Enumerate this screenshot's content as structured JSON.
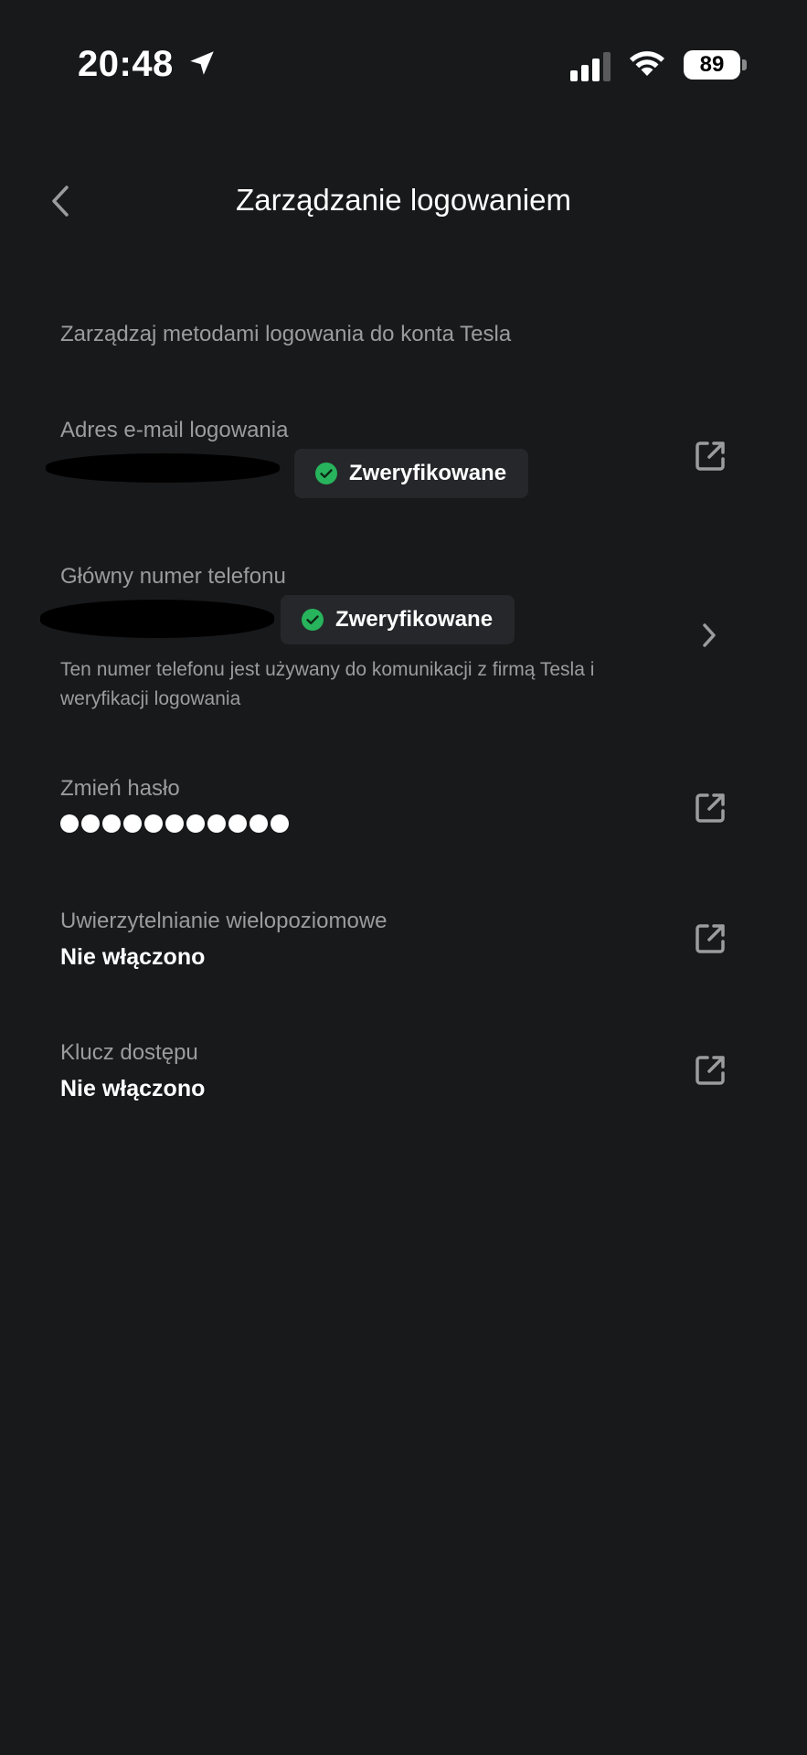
{
  "status_bar": {
    "time": "20:48",
    "battery": "89",
    "icons": [
      "location-arrow-icon",
      "signal-icon",
      "wifi-icon",
      "battery-icon"
    ]
  },
  "header": {
    "title": "Zarządzanie logowaniem",
    "back_icon": "chevron-left-icon"
  },
  "subtitle": "Zarządzaj metodami logowania do konta Tesla",
  "email": {
    "label": "Adres e-mail logowania",
    "badge": "Zweryfikowane",
    "action_icon": "external-link-icon"
  },
  "phone": {
    "label": "Główny numer telefonu",
    "badge": "Zweryfikowane",
    "helper": "Ten numer telefonu jest używany do komunikacji z firmą Tesla i weryfikacji logowania",
    "action_icon": "chevron-right-icon"
  },
  "password": {
    "label": "Zmień hasło",
    "masked_length": 11,
    "action_icon": "external-link-icon"
  },
  "mfa": {
    "label": "Uwierzytelnianie wielopoziomowe",
    "value": "Nie włączono",
    "action_icon": "external-link-icon"
  },
  "passkey": {
    "label": "Klucz dostępu",
    "value": "Nie włączono",
    "action_icon": "external-link-icon"
  },
  "colors": {
    "background": "#18191b",
    "secondary_text": "#9b9c9e",
    "badge_bg": "#26272a",
    "verified_green": "#27b45c"
  }
}
